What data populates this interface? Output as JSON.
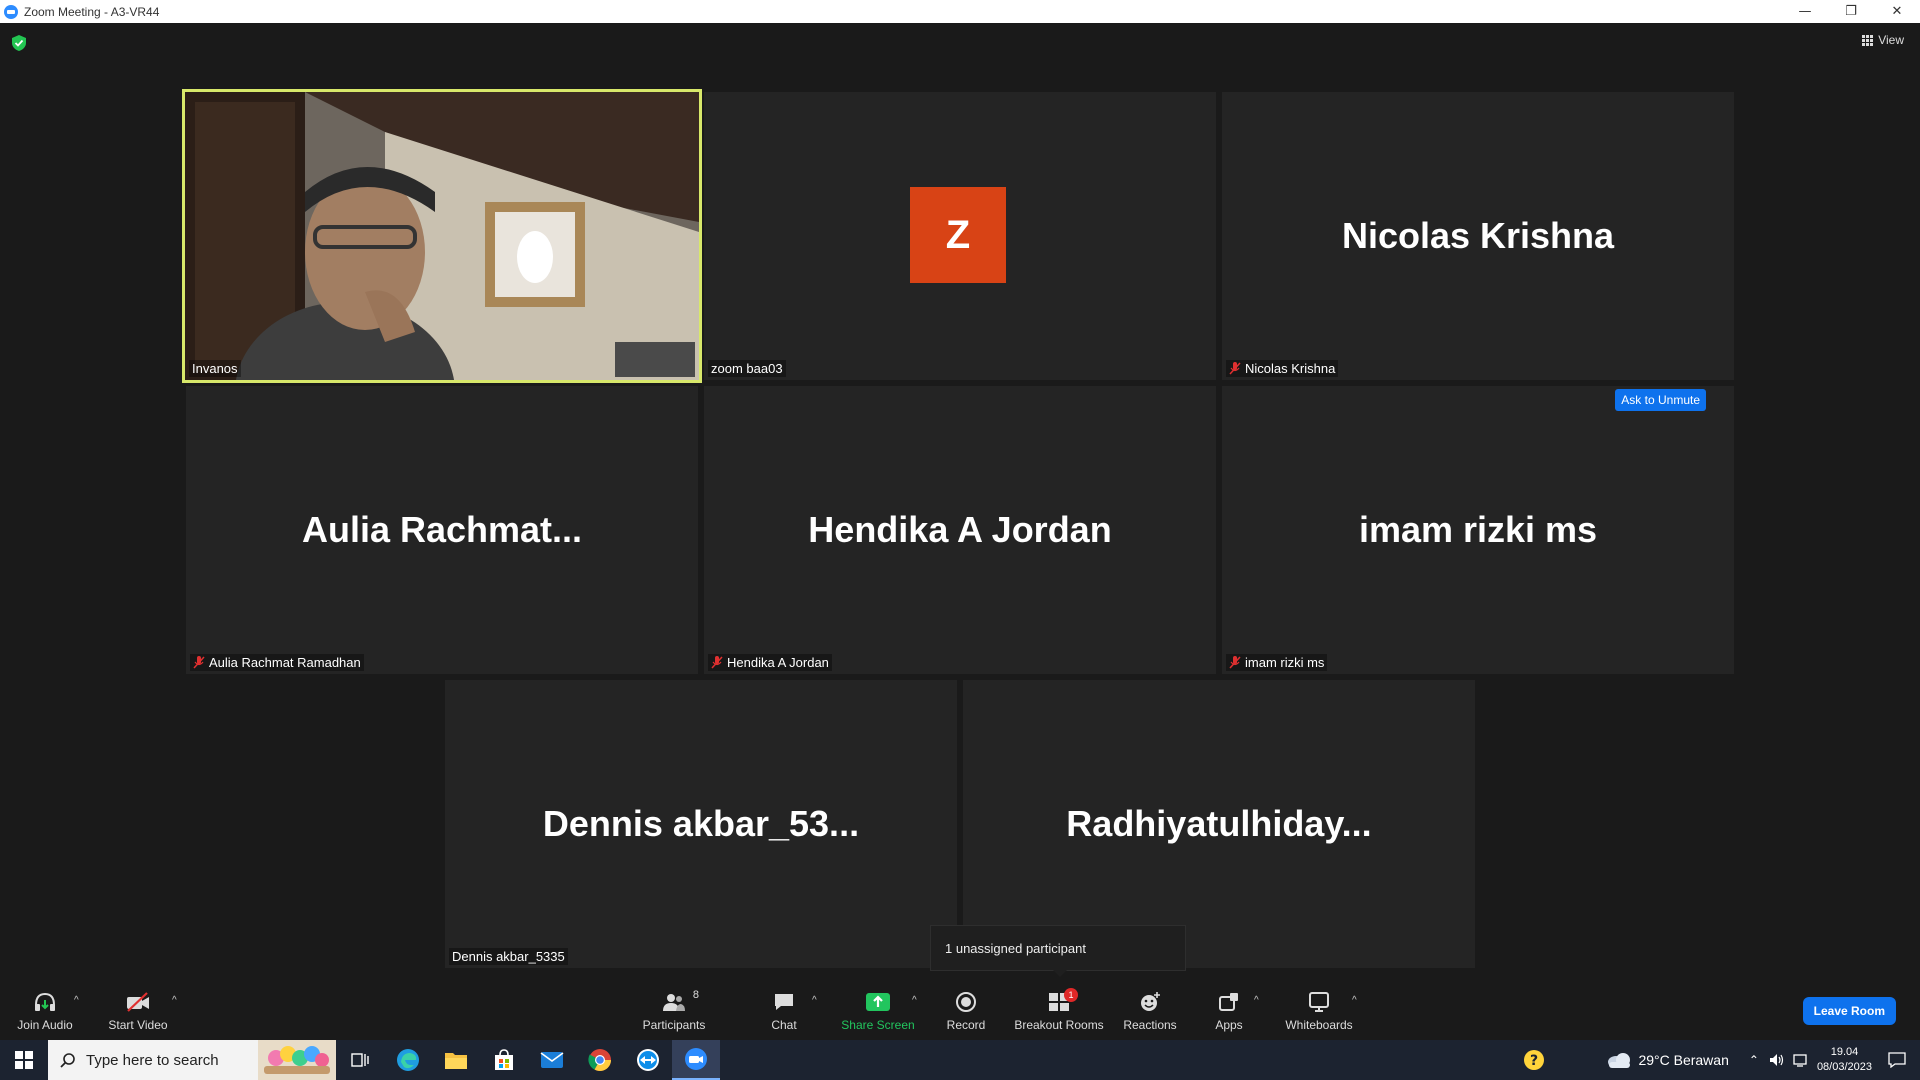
{
  "window": {
    "title": "Zoom Meeting - A3-VR44"
  },
  "top_bar": {
    "view_label": "View"
  },
  "tiles": [
    {
      "display": "",
      "label": "Invanos"
    },
    {
      "display": "Z",
      "label": "zoom baa03"
    },
    {
      "display": "Nicolas Krishna",
      "label": "Nicolas Krishna"
    },
    {
      "display": "Aulia  Rachmat...",
      "label": "Aulia Rachmat Ramadhan"
    },
    {
      "display": "Hendika A Jordan",
      "label": "Hendika A Jordan"
    },
    {
      "display": "imam rizki ms",
      "label": "imam rizki ms",
      "action": "Ask to Unmute"
    },
    {
      "display": "Dennis  akbar_53...",
      "label": "Dennis akbar_5335"
    },
    {
      "display": "Radhiyatulhiday...",
      "label": ""
    }
  ],
  "tooltip": {
    "text": "1 unassigned participant"
  },
  "toolbar": {
    "join_audio": "Join Audio",
    "start_video": "Start Video",
    "participants": "Participants",
    "participants_count": "8",
    "chat": "Chat",
    "share_screen": "Share Screen",
    "record": "Record",
    "breakout_rooms": "Breakout Rooms",
    "breakout_badge": "1",
    "reactions": "Reactions",
    "apps": "Apps",
    "whiteboards": "Whiteboards",
    "leave_room": "Leave Room",
    "share_color": "#22c55e",
    "leave_color": "#0e72ed"
  },
  "taskbar": {
    "search_placeholder": "Type here to search",
    "weather": "29°C  Berawan",
    "time": "19.04",
    "date": "08/03/2023"
  }
}
